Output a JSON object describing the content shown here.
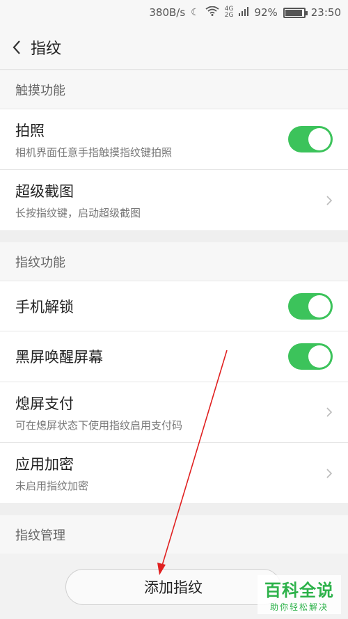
{
  "status_bar": {
    "speed": "380B/s",
    "battery": "92%",
    "time": "23:50",
    "network_top": "4G",
    "network_bottom": "2G",
    "icons": [
      "moon-icon",
      "wifi-icon",
      "signal-icon",
      "battery-icon"
    ]
  },
  "header": {
    "title": "指纹",
    "back_icon": "back-arrow-icon"
  },
  "sections": {
    "touch": {
      "title": "触摸功能",
      "items": [
        {
          "label": "拍照",
          "desc": "相机界面任意手指触摸指纹键拍照",
          "control": "toggle",
          "on": true
        },
        {
          "label": "超级截图",
          "desc": "长按指纹键，启动超级截图",
          "control": "chevron"
        }
      ]
    },
    "fingerprint": {
      "title": "指纹功能",
      "items": [
        {
          "label": "手机解锁",
          "control": "toggle",
          "on": true
        },
        {
          "label": "黑屏唤醒屏幕",
          "control": "toggle",
          "on": true
        },
        {
          "label": "熄屏支付",
          "desc": "可在熄屏状态下使用指纹启用支付码",
          "control": "chevron"
        },
        {
          "label": "应用加密",
          "desc": "未启用指纹加密",
          "control": "chevron"
        }
      ]
    },
    "manage": {
      "title": "指纹管理"
    }
  },
  "add_button": {
    "label": "添加指纹"
  },
  "watermark": {
    "main": "百科全说",
    "sub": "助你轻松解决"
  },
  "colors": {
    "toggle_on": "#3cc35b",
    "annotation_arrow": "#e02020",
    "watermark": "#2db24a"
  }
}
